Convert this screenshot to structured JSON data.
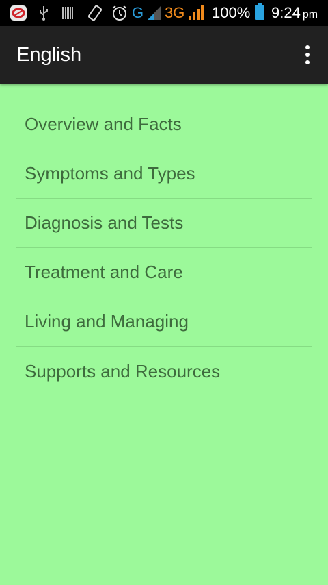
{
  "status_bar": {
    "network_type": "G",
    "network_type_2": "3G",
    "battery": "100%",
    "time": "9:24",
    "ampm": "pm",
    "icons": [
      "notification-app-icon",
      "usb-icon",
      "barcode-icon",
      "rotate-icon",
      "alarm-icon",
      "signal-icon",
      "signal-icon-2",
      "battery-icon"
    ],
    "colors": {
      "network_blue": "#2a9bd8",
      "network_orange": "#f08a1c",
      "battery": "#29a3e0"
    }
  },
  "app_bar": {
    "title": "English",
    "overflow_icon": "more-vert-icon"
  },
  "menu": {
    "items": [
      {
        "label": "Overview and Facts"
      },
      {
        "label": "Symptoms and Types"
      },
      {
        "label": "Diagnosis and Tests"
      },
      {
        "label": "Treatment and Care"
      },
      {
        "label": "Living and Managing"
      },
      {
        "label": "Supports and Resources"
      }
    ]
  },
  "colors": {
    "background": "#9cf99a",
    "app_bar": "#212121",
    "item_text": "#3e6b3d",
    "divider": "#86dc84"
  }
}
